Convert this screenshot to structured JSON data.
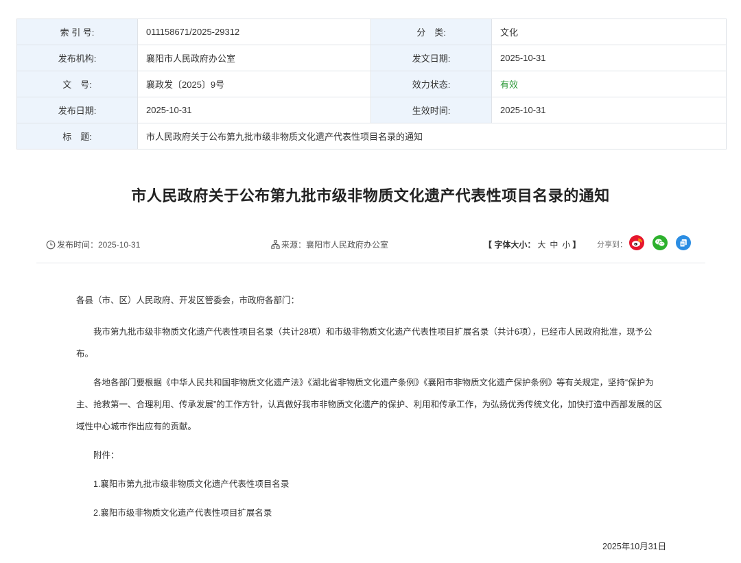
{
  "meta": {
    "index_label": "索 引 号:",
    "index_value": "011158671/2025-29312",
    "category_label": "分　类:",
    "category_value": "文化",
    "publisher_label": "发布机构:",
    "publisher_value": "襄阳市人民政府办公室",
    "issue_date_label": "发文日期:",
    "issue_date_value": "2025-10-31",
    "doc_no_label": "文　号:",
    "doc_no_value": "襄政发〔2025〕9号",
    "status_label": "效力状态:",
    "status_value": "有效",
    "pub_date_label": "发布日期:",
    "pub_date_value": "2025-10-31",
    "effective_label": "生效时间:",
    "effective_value": "2025-10-31",
    "title_label": "标　题:",
    "title_value": "市人民政府关于公布第九批市级非物质文化遗产代表性项目名录的通知"
  },
  "article": {
    "title": "市人民政府关于公布第九批市级非物质文化遗产代表性项目名录的通知",
    "published_text": "发布时间：2025-10-31",
    "source_text": "来源：襄阳市人民政府办公室",
    "font_size_prefix": "【 字体大小：",
    "font_large": "大",
    "font_medium": "中",
    "font_small": "小",
    "font_size_suffix": "】",
    "share_label": "分享到：",
    "greeting": "各县（市、区）人民政府、开发区管委会，市政府各部门：",
    "para1": "我市第九批市级非物质文化遗产代表性项目名录（共计28项）和市级非物质文化遗产代表性项目扩展名录（共计6项），已经市人民政府批准，现予公布。",
    "para2": "各地各部门要根据《中华人民共和国非物质文化遗产法》《湖北省非物质文化遗产条例》《襄阳市非物质文化遗产保护条例》等有关规定，坚持“保护为主、抢救第一、合理利用、传承发展”的工作方针，认真做好我市非物质文化遗产的保护、利用和传承工作，为弘扬优秀传统文化，加快打造中西部发展的区域性中心城市作出应有的贡献。",
    "attachment_label": "附件：",
    "attachment1": "1.襄阳市第九批市级非物质文化遗产代表性项目名录",
    "attachment2": "2.襄阳市级非物质文化遗产代表性项目扩展名录",
    "sign_date": "2025年10月31日"
  },
  "icons": {
    "clock": "clock-icon",
    "source": "sitemap-icon",
    "weibo": "weibo-icon",
    "wechat": "wechat-icon",
    "copy": "copy-icon"
  },
  "colors": {
    "label_bg": "#edf4fc",
    "border": "#dfe3e8",
    "status_green": "#2e9a3a",
    "weibo": "#e6162d",
    "wechat": "#2db12d",
    "copy": "#2b8de3"
  }
}
